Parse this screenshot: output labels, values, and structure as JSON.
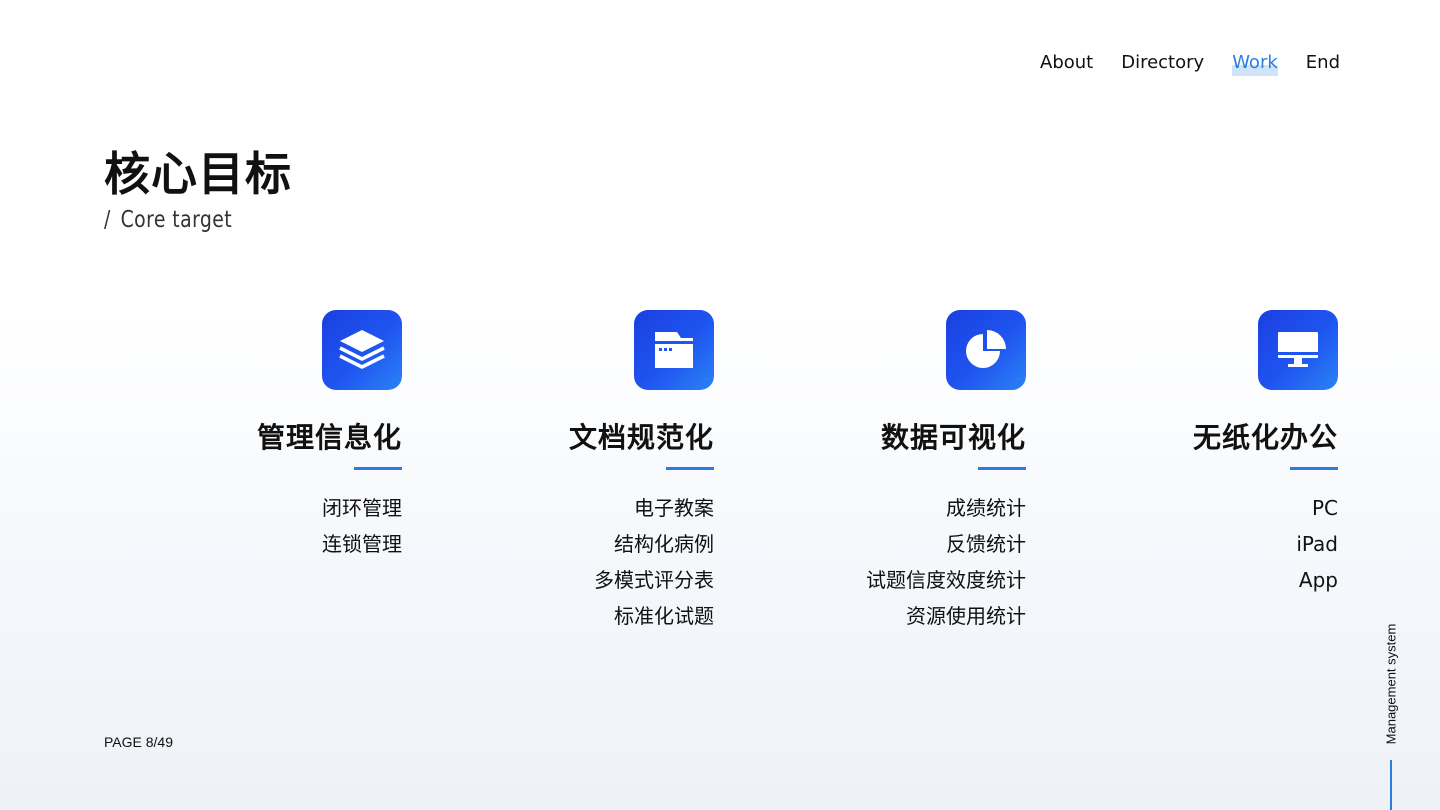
{
  "nav": {
    "items": [
      {
        "label": "About",
        "active": false
      },
      {
        "label": "Directory",
        "active": false
      },
      {
        "label": "Work",
        "active": true
      },
      {
        "label": "End",
        "active": false
      }
    ]
  },
  "heading": {
    "title": "核心目标",
    "slash": "/",
    "subtitle": "Core target"
  },
  "cards": [
    {
      "icon": "layers-icon",
      "title": "管理信息化",
      "items": [
        "闭环管理",
        "连锁管理"
      ]
    },
    {
      "icon": "folder-icon",
      "title": "文档规范化",
      "items": [
        "电子教案",
        "结构化病例",
        "多模式评分表",
        "标准化试题"
      ]
    },
    {
      "icon": "pie-chart-icon",
      "title": "数据可视化",
      "items": [
        "成绩统计",
        "反馈统计",
        "试题信度效度统计",
        "资源使用统计"
      ]
    },
    {
      "icon": "monitor-icon",
      "title": "无纸化办公",
      "items": [
        "PC",
        "iPad",
        "App"
      ]
    }
  ],
  "footer": {
    "page": "PAGE 8/49",
    "side_label": "Management system"
  },
  "colors": {
    "accent": "#2a7de1",
    "icon_gradient_start": "#1a3fe0",
    "icon_gradient_end": "#2b83f6"
  }
}
